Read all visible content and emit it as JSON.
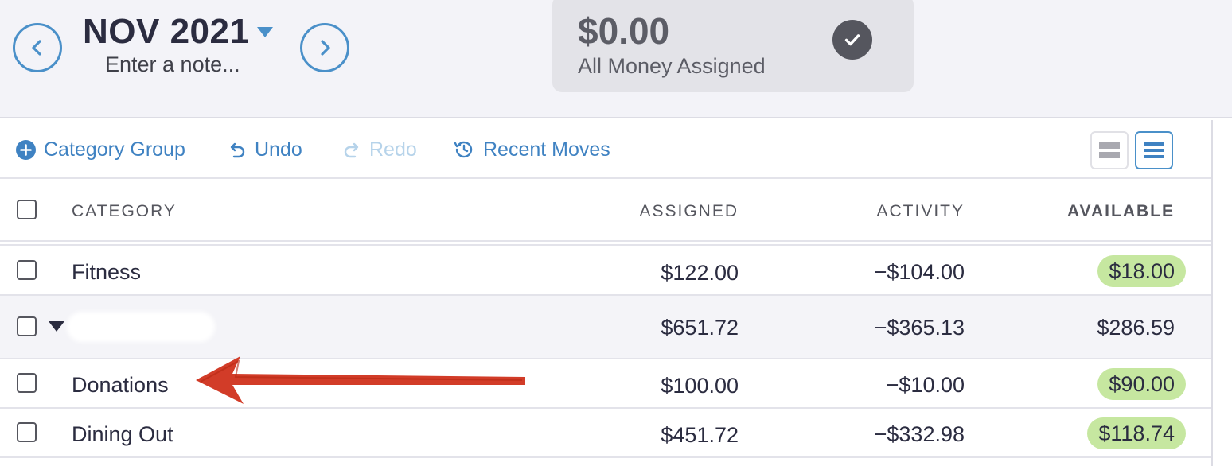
{
  "header": {
    "month": "NOV 2021",
    "note_placeholder": "Enter a note...",
    "to_be_budgeted": {
      "amount": "$0.00",
      "label": "All Money Assigned"
    },
    "icons": {
      "prev": "chevron-left-circle-icon",
      "next": "chevron-right-circle-icon",
      "caret": "caret-down-icon",
      "status": "checkmark-circle-icon"
    }
  },
  "toolbar": {
    "category_group_label": "Category Group",
    "undo_label": "Undo",
    "redo_label": "Redo",
    "recent_moves_label": "Recent Moves",
    "redo_enabled": false,
    "active_view": "list"
  },
  "table": {
    "columns": {
      "category": "CATEGORY",
      "assigned": "ASSIGNED",
      "activity": "ACTIVITY",
      "available": "AVAILABLE"
    },
    "rows": [
      {
        "type": "category",
        "name": "Fitness",
        "assigned": "$122.00",
        "activity": "−$104.00",
        "available": "$18.00",
        "available_status": "positive"
      },
      {
        "type": "group",
        "name": "",
        "assigned": "$651.72",
        "activity": "−$365.13",
        "available": "$286.59",
        "expanded": true,
        "name_redacted": true
      },
      {
        "type": "category",
        "name": "Donations",
        "assigned": "$100.00",
        "activity": "−$10.00",
        "available": "$90.00",
        "available_status": "positive"
      },
      {
        "type": "category",
        "name": "Dining Out",
        "assigned": "$451.72",
        "activity": "−$332.98",
        "available": "$118.74",
        "available_status": "positive"
      }
    ]
  },
  "annotation": {
    "type": "arrow",
    "color": "#d0321c",
    "points_to": "Donations"
  },
  "colors": {
    "accent": "#4a90c9",
    "available_pill": "#c6e7a0",
    "header_bg": "#f3f3f8",
    "assigned_box": "#e3e3e8"
  }
}
